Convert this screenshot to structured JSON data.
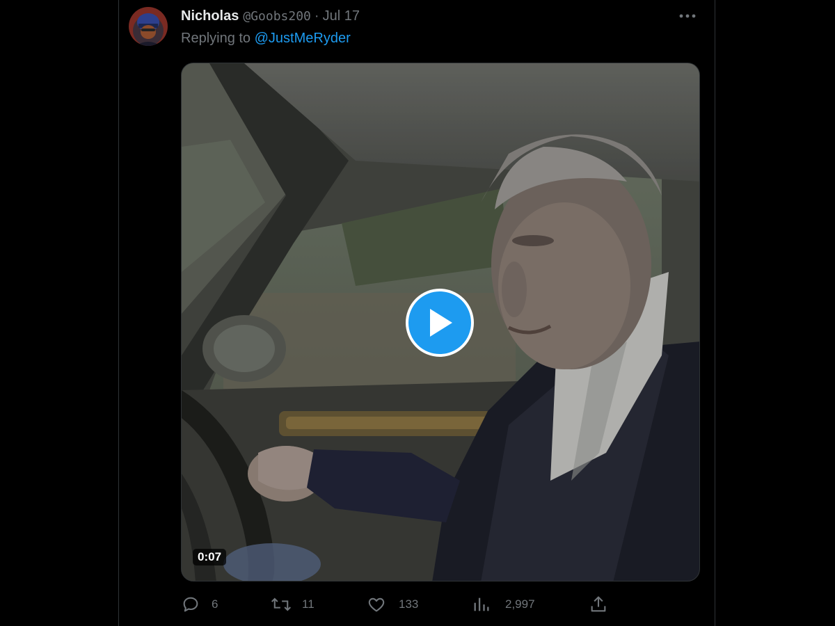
{
  "tweet": {
    "author": {
      "display_name": "Nicholas",
      "handle": "@Goobs200",
      "avatar_icon": "avatar-image"
    },
    "separator": "·",
    "date": "Jul 17",
    "reply": {
      "prefix": "Replying to",
      "mention": "@JustMeRyder"
    },
    "more_icon": "more-dots-icon",
    "media": {
      "type": "video",
      "duration": "0:07",
      "play_icon": "play-icon"
    },
    "actions": {
      "replies": {
        "icon": "reply-icon",
        "count": "6"
      },
      "retweets": {
        "icon": "retweet-icon",
        "count": "11"
      },
      "likes": {
        "icon": "heart-icon",
        "count": "133"
      },
      "views": {
        "icon": "views-icon",
        "count": "2,997"
      },
      "share": {
        "icon": "share-icon"
      }
    }
  },
  "colors": {
    "background": "#000000",
    "text_primary": "#e7e9ea",
    "text_secondary": "#71767b",
    "accent": "#1d9bf0",
    "border": "#2f3336"
  }
}
